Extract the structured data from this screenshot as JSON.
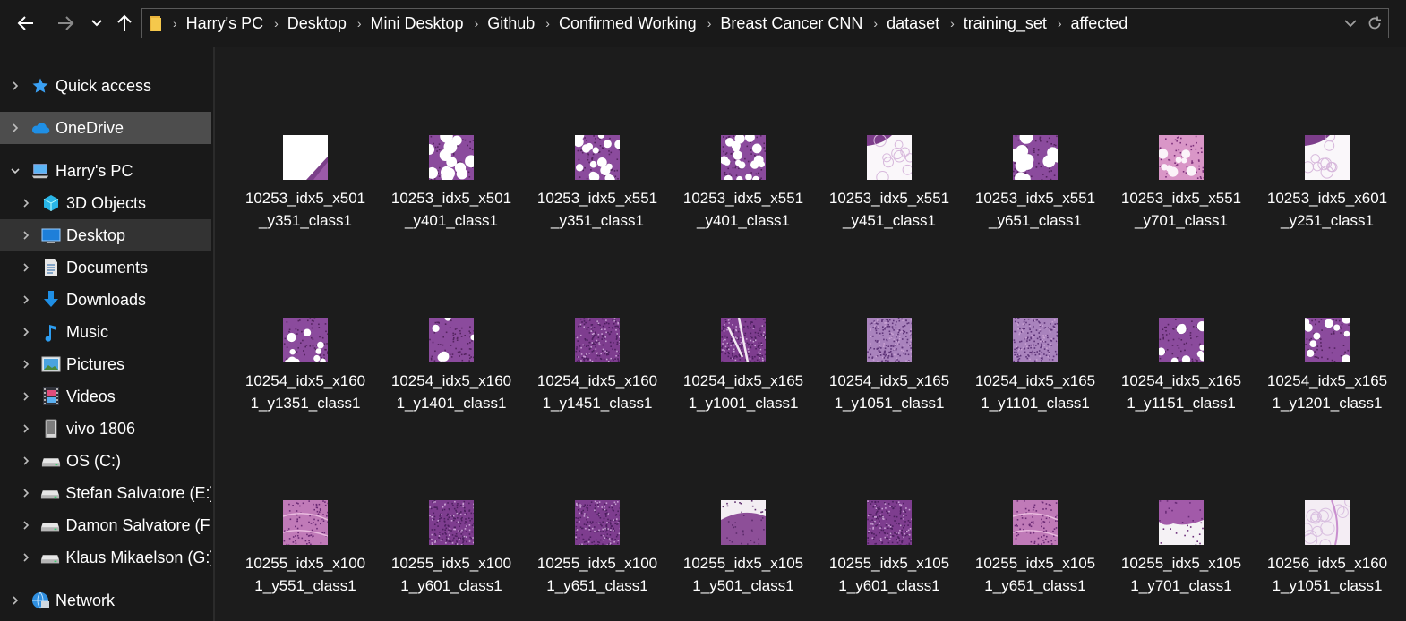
{
  "nav": {
    "back_icon": "back-arrow-icon",
    "forward_icon": "forward-arrow-icon",
    "recent_icon": "chevron-down-icon",
    "up_icon": "up-arrow-icon"
  },
  "address": {
    "breadcrumbs": [
      "Harry's PC",
      "Desktop",
      "Mini Desktop",
      "Github",
      "Confirmed Working",
      "Breast Cancer CNN",
      "dataset",
      "training_set",
      "affected"
    ],
    "dropdown_icon": "chevron-down-icon",
    "refresh_icon": "refresh-icon"
  },
  "sidebar": {
    "items": [
      {
        "label": "Quick access",
        "icon": "star-icon"
      },
      {
        "label": "OneDrive",
        "icon": "cloud-icon"
      },
      {
        "label": "Harry's PC",
        "icon": "computer-icon"
      },
      {
        "label": "3D Objects",
        "icon": "cube-icon"
      },
      {
        "label": "Desktop",
        "icon": "desktop-icon"
      },
      {
        "label": "Documents",
        "icon": "document-icon"
      },
      {
        "label": "Downloads",
        "icon": "download-icon"
      },
      {
        "label": "Music",
        "icon": "music-note-icon"
      },
      {
        "label": "Pictures",
        "icon": "pictures-icon"
      },
      {
        "label": "Videos",
        "icon": "film-icon"
      },
      {
        "label": "vivo 1806",
        "icon": "phone-icon"
      },
      {
        "label": "OS (C:)",
        "icon": "drive-icon"
      },
      {
        "label": "Stefan Salvatore (E:)",
        "icon": "drive-icon"
      },
      {
        "label": "Damon Salvatore (F:",
        "icon": "drive-icon"
      },
      {
        "label": "Klaus Mikaelson (G:)",
        "icon": "drive-icon"
      },
      {
        "label": "Network",
        "icon": "network-icon"
      }
    ]
  },
  "files": [
    {
      "line1": "10253_idx5_x501",
      "line2": "_y351_class1"
    },
    {
      "line1": "10253_idx5_x501",
      "line2": "_y401_class1"
    },
    {
      "line1": "10253_idx5_x551",
      "line2": "_y351_class1"
    },
    {
      "line1": "10253_idx5_x551",
      "line2": "_y401_class1"
    },
    {
      "line1": "10253_idx5_x551",
      "line2": "_y451_class1"
    },
    {
      "line1": "10253_idx5_x551",
      "line2": "_y651_class1"
    },
    {
      "line1": "10253_idx5_x551",
      "line2": "_y701_class1"
    },
    {
      "line1": "10253_idx5_x601",
      "line2": "_y251_class1"
    },
    {
      "line1": "10254_idx5_x160",
      "line2": "1_y1351_class1"
    },
    {
      "line1": "10254_idx5_x160",
      "line2": "1_y1401_class1"
    },
    {
      "line1": "10254_idx5_x160",
      "line2": "1_y1451_class1"
    },
    {
      "line1": "10254_idx5_x165",
      "line2": "1_y1001_class1"
    },
    {
      "line1": "10254_idx5_x165",
      "line2": "1_y1051_class1"
    },
    {
      "line1": "10254_idx5_x165",
      "line2": "1_y1101_class1"
    },
    {
      "line1": "10254_idx5_x165",
      "line2": "1_y1151_class1"
    },
    {
      "line1": "10254_idx5_x165",
      "line2": "1_y1201_class1"
    },
    {
      "line1": "10255_idx5_x100",
      "line2": "1_y551_class1"
    },
    {
      "line1": "10255_idx5_x100",
      "line2": "1_y601_class1"
    },
    {
      "line1": "10255_idx5_x100",
      "line2": "1_y651_class1"
    },
    {
      "line1": "10255_idx5_x105",
      "line2": "1_y501_class1"
    },
    {
      "line1": "10255_idx5_x105",
      "line2": "1_y601_class1"
    },
    {
      "line1": "10255_idx5_x105",
      "line2": "1_y651_class1"
    },
    {
      "line1": "10255_idx5_x105",
      "line2": "1_y701_class1"
    },
    {
      "line1": "10256_idx5_x160",
      "line2": "1_y1051_class1"
    }
  ]
}
